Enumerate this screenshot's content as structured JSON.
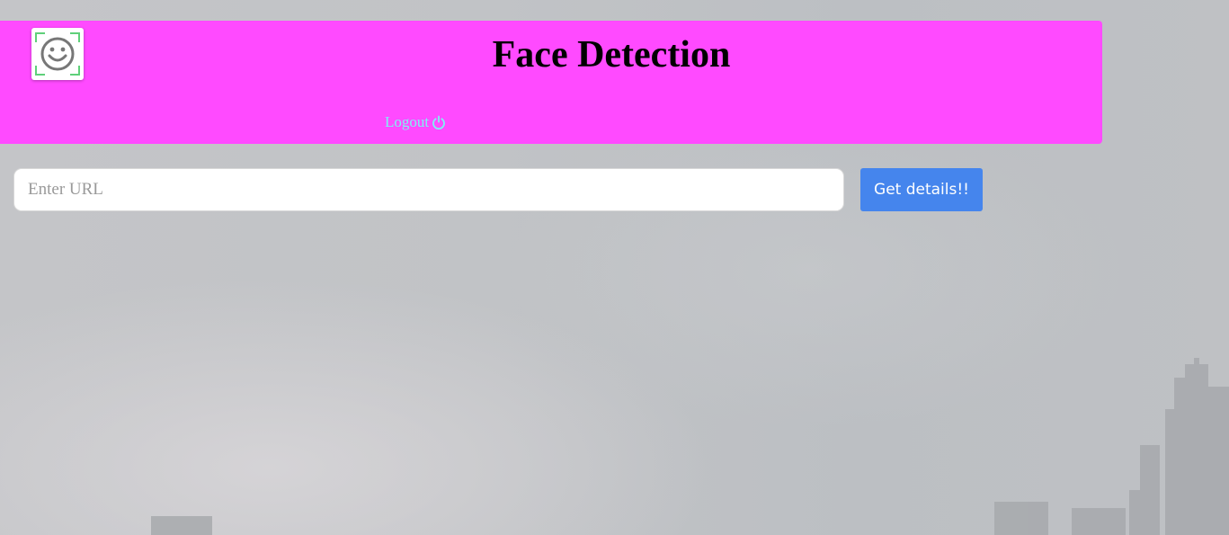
{
  "header": {
    "title": "Face Detection",
    "background_color": "#ff4aff",
    "logo_icon": "face-scan-icon",
    "logout_label": "Logout",
    "logout_icon": "power-icon",
    "logout_color": "#7ff2f2"
  },
  "form": {
    "url_placeholder": "Enter URL",
    "url_value": "",
    "submit_label": "Get details!!",
    "submit_color": "#4585ed"
  },
  "background": {
    "description_icon": "city-skyline-background"
  }
}
